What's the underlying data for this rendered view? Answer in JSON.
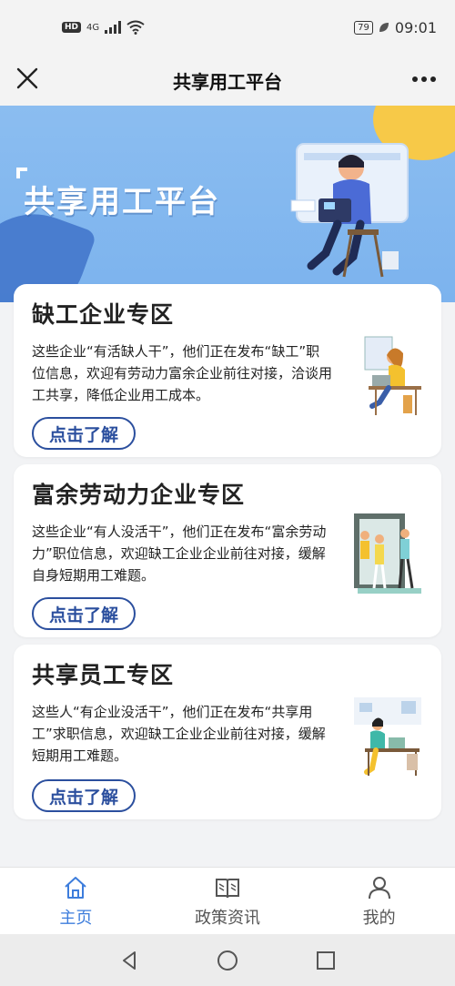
{
  "status_bar": {
    "hd": "HD",
    "network": "4G",
    "battery": "79",
    "time": "09:01"
  },
  "titlebar": {
    "title": "共享用工平台"
  },
  "banner": {
    "title": "共享用工平台"
  },
  "cards": [
    {
      "title": "缺工企业专区",
      "desc": "这些企业“有活缺人干”，他们正在发布“缺工”职位信息，欢迎有劳动力富余企业前往对接，洽谈用工共享，降低企业用工成本。",
      "button": "点击了解"
    },
    {
      "title": "富余劳动力企业专区",
      "desc": "这些企业“有人没活干”，他们正在发布“富余劳动力”职位信息，欢迎缺工企业企业前往对接，缓解自身短期用工难题。",
      "button": "点击了解"
    },
    {
      "title": "共享员工专区",
      "desc": "这些人“有企业没活干”，他们正在发布“共享用工”求职信息，欢迎缺工企业企业前往对接，缓解短期用工难题。",
      "button": "点击了解"
    }
  ],
  "bottom_nav": {
    "items": [
      {
        "label": "主页",
        "icon": "home-icon",
        "active": true
      },
      {
        "label": "政策资讯",
        "icon": "book-icon",
        "active": false
      },
      {
        "label": "我的",
        "icon": "user-icon",
        "active": false
      }
    ]
  },
  "colors": {
    "accent": "#3d7ddc",
    "button_border": "#2b4f9e",
    "banner_bg": "#8bbdf0"
  }
}
